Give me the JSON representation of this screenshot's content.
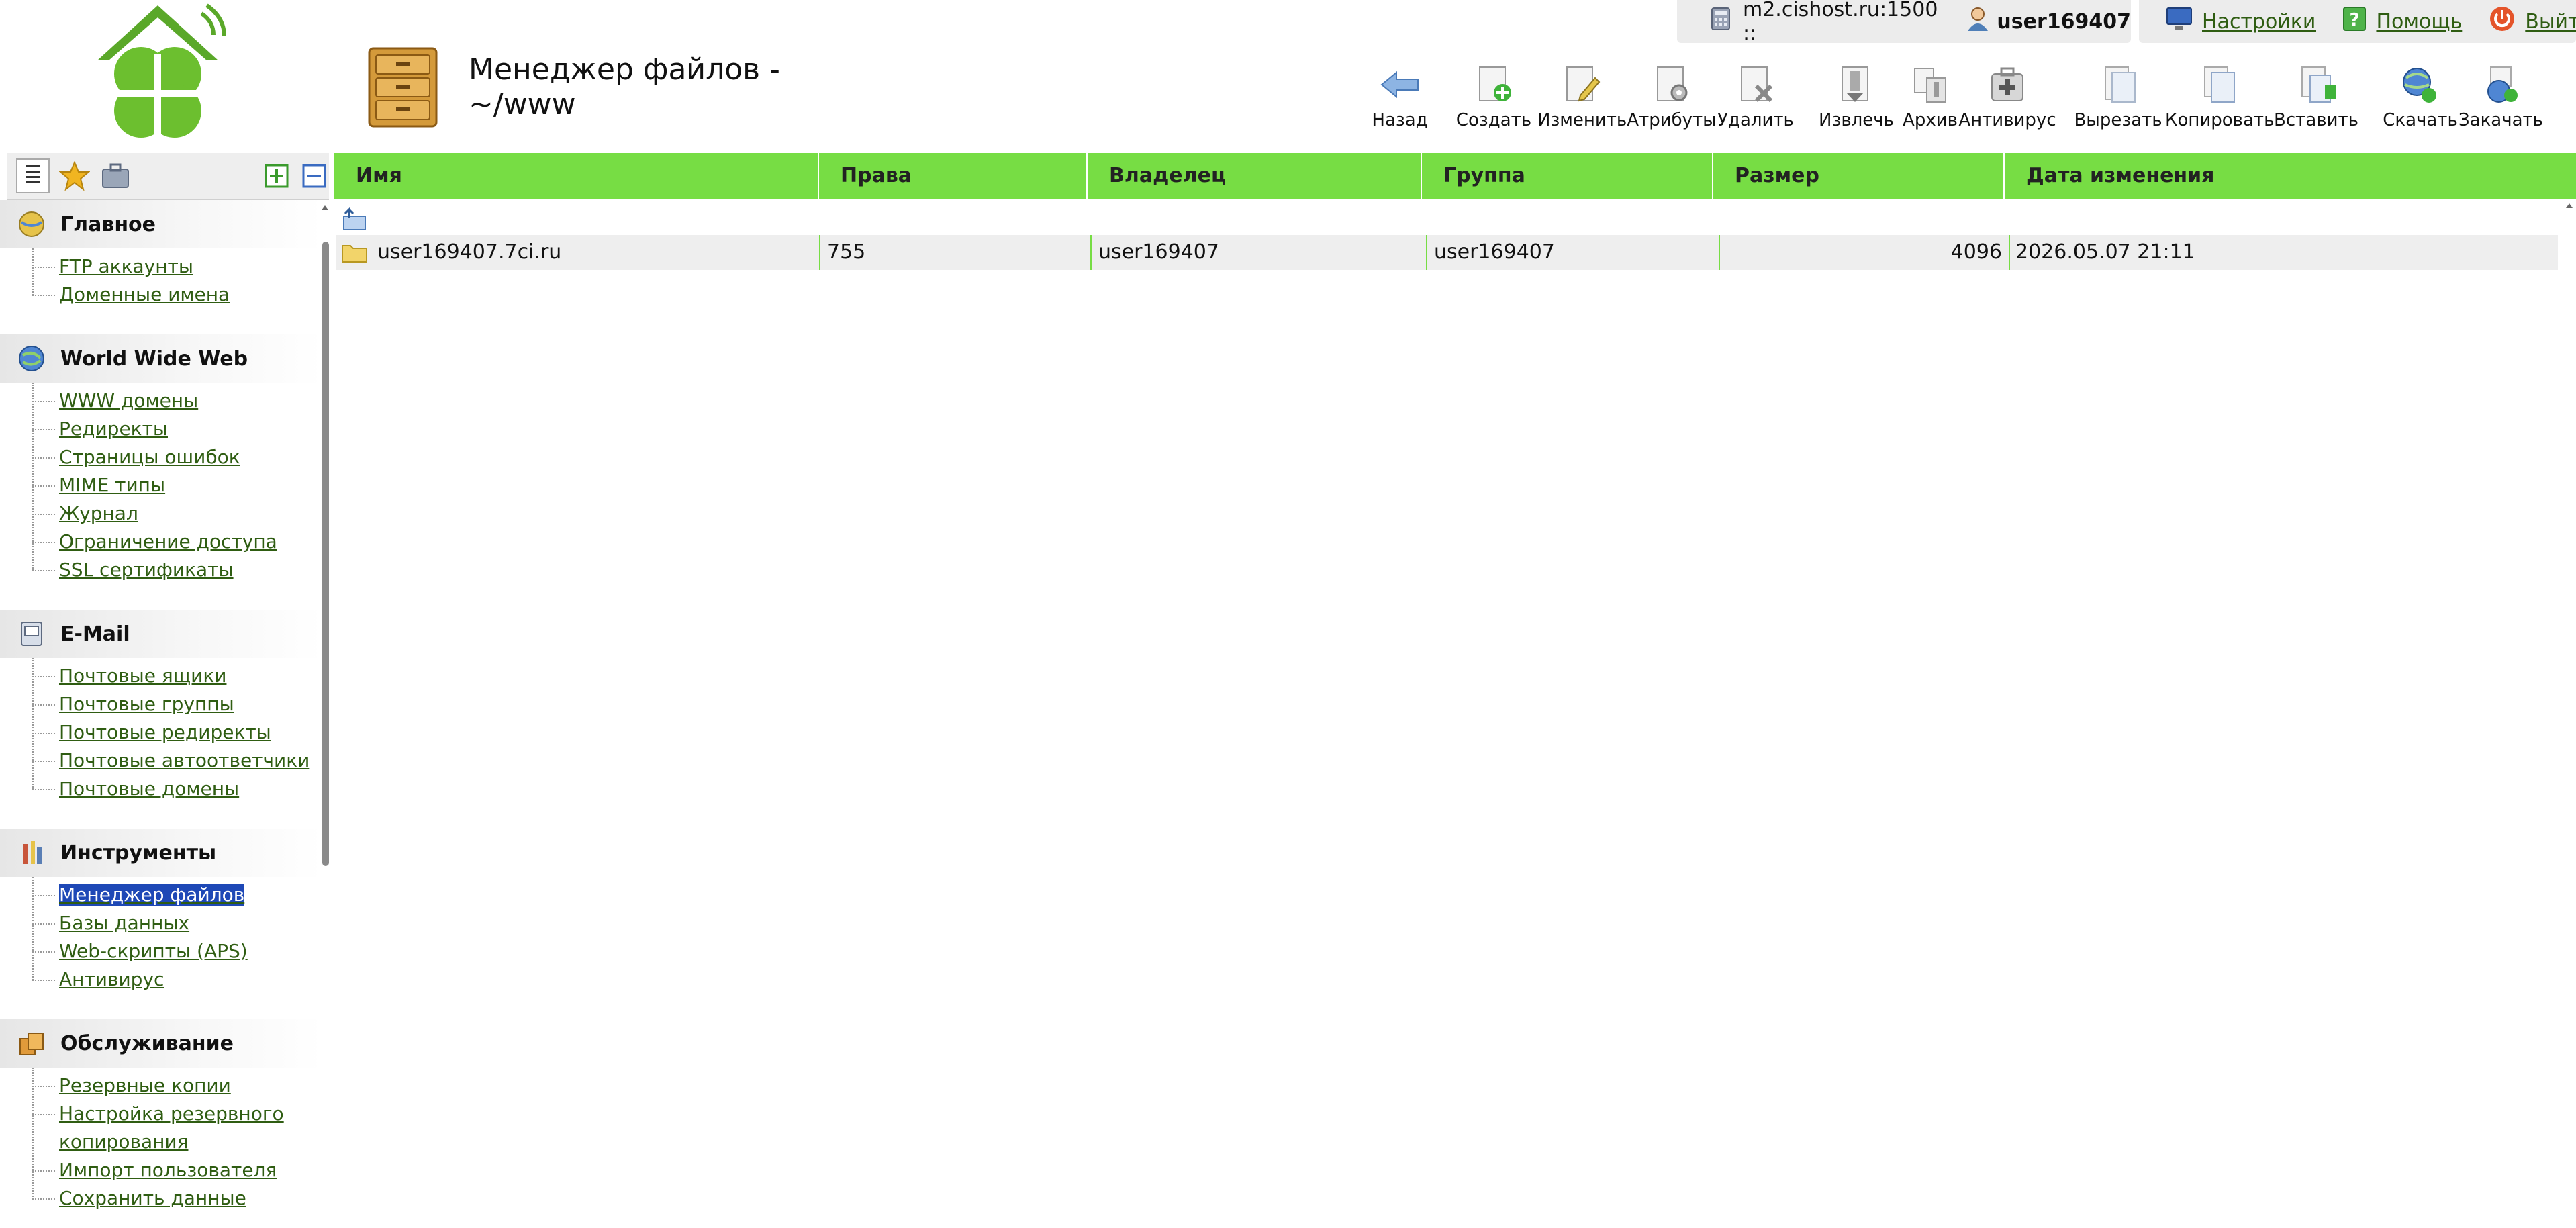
{
  "header": {
    "title_line1": "Менеджер файлов -",
    "title_line2": "~/www",
    "server": "m2.cishost.ru:1500 ::",
    "user": "user169407",
    "links": [
      {
        "label": "Настройки"
      },
      {
        "label": "Помощь"
      },
      {
        "label": "Выйти"
      }
    ]
  },
  "toolbar": [
    {
      "label": "Назад",
      "icon": "back-arrow-icon"
    },
    {
      "label": "Создать",
      "icon": "create-file-icon"
    },
    {
      "label": "Изменить",
      "icon": "edit-file-icon"
    },
    {
      "label": "Атрибуты",
      "icon": "attributes-icon"
    },
    {
      "label": "Удалить",
      "icon": "delete-file-icon"
    },
    {
      "label": "Извлечь",
      "icon": "extract-icon"
    },
    {
      "label": "Архив",
      "icon": "archive-icon"
    },
    {
      "label": "Антивирус",
      "icon": "antivirus-icon"
    },
    {
      "label": "Вырезать",
      "icon": "cut-icon"
    },
    {
      "label": "Копировать",
      "icon": "copy-icon"
    },
    {
      "label": "Вставить",
      "icon": "paste-icon"
    },
    {
      "label": "Скачать",
      "icon": "download-icon"
    },
    {
      "label": "Закачать",
      "icon": "upload-icon"
    }
  ],
  "sidebar": {
    "sections": [
      {
        "title": "Главное",
        "icon": "home-globe-icon",
        "items": [
          "FTP аккаунты",
          "Доменные имена"
        ]
      },
      {
        "title": "World Wide Web",
        "icon": "globe-icon",
        "items": [
          "WWW домены",
          "Редиректы",
          "Страницы ошибок",
          "MIME типы",
          "Журнал",
          "Ограничение доступа",
          "SSL сертификаты"
        ]
      },
      {
        "title": "E-Mail",
        "icon": "mail-icon",
        "items": [
          "Почтовые ящики",
          "Почтовые группы",
          "Почтовые редиректы",
          "Почтовые автоответчики",
          "Почтовые домены"
        ]
      },
      {
        "title": "Инструменты",
        "icon": "tools-icon",
        "items": [
          "Менеджер файлов",
          "Базы данных",
          "Web-скрипты (APS)",
          "Антивирус"
        ]
      },
      {
        "title": "Обслуживание",
        "icon": "maintenance-icon",
        "items": [
          "Резервные копии",
          "Настройка резервного копирования",
          "Импорт пользователя",
          "Сохранить данные"
        ]
      }
    ],
    "active_item": "Менеджер файлов"
  },
  "table": {
    "columns": [
      "Имя",
      "Права",
      "Владелец",
      "Группа",
      "Размер",
      "Дата изменения"
    ],
    "rows": [
      {
        "name": "user169407.7ci.ru",
        "rights": "755",
        "owner": "user169407",
        "group": "user169407",
        "size": "4096",
        "modified": "2026.05.07 21:11"
      }
    ]
  },
  "colors": {
    "accent": "#77dd44",
    "link": "#2f5d12",
    "selected": "#1e48b6"
  }
}
